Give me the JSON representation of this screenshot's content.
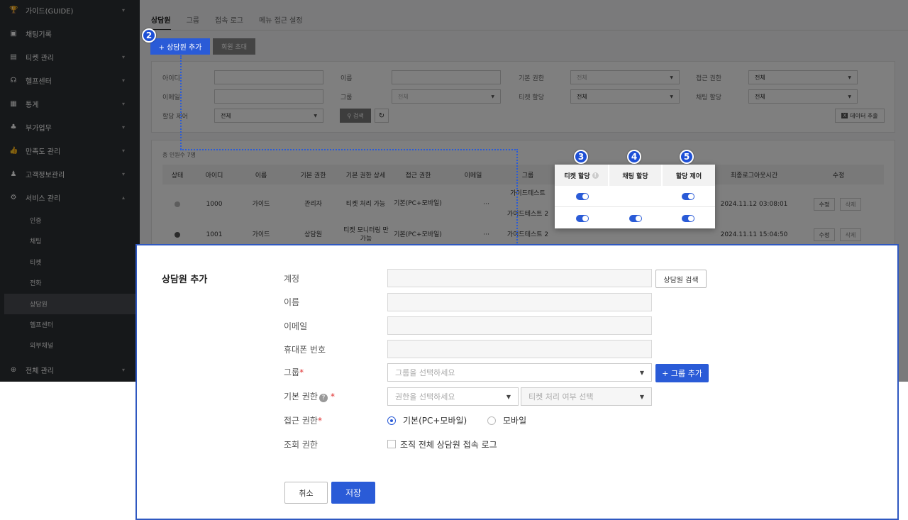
{
  "sidebar": {
    "items": [
      {
        "label": "가이드(GUIDE)",
        "icon": "trophy-icon"
      },
      {
        "label": "채팅기록",
        "icon": "chat-icon"
      },
      {
        "label": "티켓 관리",
        "icon": "ticket-icon"
      },
      {
        "label": "헬프센터",
        "icon": "headset-icon"
      },
      {
        "label": "통계",
        "icon": "chart-icon"
      },
      {
        "label": "부가업무",
        "icon": "people-icon"
      },
      {
        "label": "만족도 관리",
        "icon": "thumbs-up-icon"
      },
      {
        "label": "고객정보관리",
        "icon": "user-icon"
      },
      {
        "label": "서비스 관리",
        "icon": "gear-icon"
      },
      {
        "label": "전체 관리",
        "icon": "plus-circle-icon"
      }
    ],
    "sub_items": [
      "인증",
      "채팅",
      "티켓",
      "전화",
      "상담원",
      "헬프센터",
      "외부채널"
    ]
  },
  "tabs": [
    "상담원",
    "그룹",
    "접속 로그",
    "메뉴 접근 설정"
  ],
  "toolbar": {
    "add_label": "+ 상담원 추가",
    "invite_label": "회원 초대"
  },
  "filters": {
    "id_label": "아이디",
    "name_label": "이름",
    "base_perm_label": "기본 권한",
    "access_perm_label": "접근 권한",
    "email_label": "이메일",
    "group_label": "그룹",
    "ticket_assign_label": "티켓 할당",
    "chat_assign_label": "채팅 할당",
    "assign_ctrl_label": "할당 제어",
    "all": "전체",
    "search_label": "검색",
    "export_label": "데이터 추출"
  },
  "table": {
    "count_label": "총 인원수 7명",
    "headers": [
      "상태",
      "아이디",
      "이름",
      "기본 권한",
      "기본 권한 상세",
      "접근 권한",
      "이메일",
      "그룹",
      "최종로그아웃시간",
      "수정"
    ],
    "rows": [
      {
        "id": "1000",
        "name": "가이드",
        "base": "관리자",
        "detail": "티켓 처리 가능",
        "access": "기본(PC+모바일)",
        "email": "···",
        "groups": [
          "가이드테스트",
          "가이드테스트 2"
        ],
        "logout": "2024.11.12 03:08:01",
        "edit": "수정",
        "del": "삭제"
      },
      {
        "id": "1001",
        "name": "가이드",
        "base": "상담원",
        "detail": "티켓 모니터링 만 가능",
        "access": "기본(PC+모바일)",
        "email": "···",
        "groups": [
          "가이드테스트 2"
        ],
        "logout": "2024.11.11 15:04:50",
        "edit": "수정",
        "del": "삭제"
      }
    ]
  },
  "popup": {
    "headers": [
      "티켓 할당",
      "채팅 할당",
      "할당 제어"
    ]
  },
  "badges": [
    "2",
    "3",
    "4",
    "5"
  ],
  "modal": {
    "title": "상담원 추가",
    "account_label": "계정",
    "search_agent_label": "상담원 검색",
    "name_label": "이름",
    "email_label": "이메일",
    "phone_label": "휴대폰 번호",
    "group_label": "그룹",
    "group_placeholder": "그룹을 선택하세요",
    "add_group_label": "+ 그룹 추가",
    "perm_label": "기본 권한",
    "perm_placeholder": "권한을 선택하세요",
    "ticket_placeholder": "티켓 처리 여부 선택",
    "access_label": "접근 권한",
    "access_opt1": "기본(PC+모바일)",
    "access_opt2": "모바일",
    "view_label": "조회 권한",
    "view_opt": "조직 전체 상담원 접속 로그",
    "cancel_label": "취소",
    "save_label": "저장",
    "required_mark": "*"
  },
  "colors": {
    "accent": "#2a5bd7",
    "sidebar": "#2d3035",
    "required": "#e03131"
  }
}
